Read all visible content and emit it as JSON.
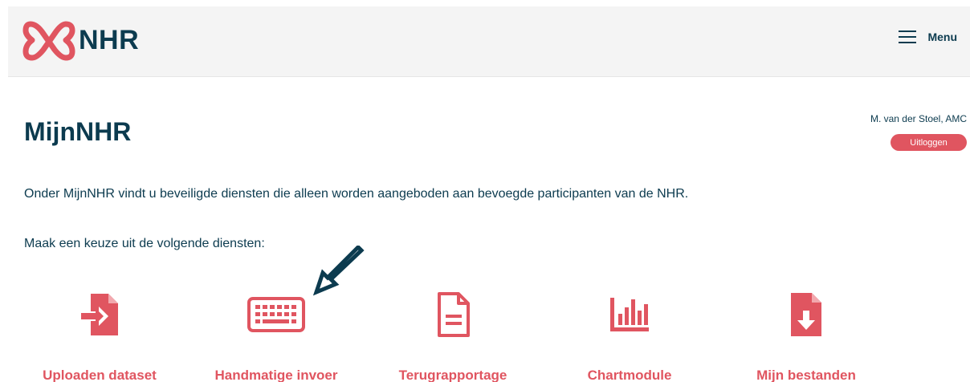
{
  "header": {
    "logo_text": "NHR",
    "menu_label": "Menu"
  },
  "page": {
    "title": "MijnNHR",
    "user_name": "M. van der Stoel, AMC",
    "logout_label": "Uitloggen",
    "intro_text": "Onder MijnNHR vindt u beveiligde diensten die alleen worden aangeboden aan bevoegde participanten van de NHR.",
    "prompt_text": "Maak een keuze uit de volgende diensten:"
  },
  "services": [
    {
      "label": "Uploaden dataset",
      "icon": "file-import-icon"
    },
    {
      "label": "Handmatige invoer",
      "icon": "keyboard-icon"
    },
    {
      "label": "Terugrapportage",
      "icon": "document-icon"
    },
    {
      "label": "Chartmodule",
      "icon": "bar-chart-icon"
    },
    {
      "label": "Mijn bestanden",
      "icon": "file-download-icon"
    }
  ],
  "colors": {
    "brand_red": "#e05560",
    "navy": "#0c3b4f",
    "header_bg": "#f4f4f4"
  }
}
